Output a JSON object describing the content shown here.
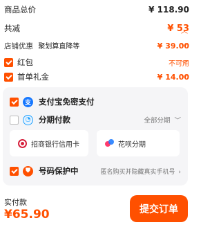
{
  "summary": {
    "goods_total": {
      "label": "商品总价",
      "value": "¥ 118.90"
    },
    "total_discount": {
      "label": "共减",
      "value": "¥ 53"
    },
    "store_discount": {
      "label": "店铺优惠",
      "tag": "聚划算直降等",
      "value": "¥ 39.00"
    },
    "red_packet": {
      "label": "红包",
      "value": "不可用"
    },
    "gift": {
      "label": "首单礼金",
      "value": "¥ 14.00"
    }
  },
  "payment": {
    "alipay": {
      "label": "支付宝免密支付",
      "icon": "alipay-icon"
    },
    "installment": {
      "label": "分期付款",
      "right": "全部分期",
      "icon": "installment-icon"
    },
    "cards": [
      {
        "label": "招商银行信用卡",
        "icon": "cmb-bank-logo"
      },
      {
        "label": "花呗分期",
        "icon": "huabei-logo"
      }
    ],
    "number_protect": {
      "label": "号码保护中",
      "right": "匿名购买并隐藏真实手机号",
      "icon": "shield-icon"
    }
  },
  "footer": {
    "actual_label": "实付款",
    "actual_value": "¥65.90",
    "submit_label": "提交订单"
  },
  "colors": {
    "accent": "#ff5000",
    "alipay": "#1677ff"
  }
}
